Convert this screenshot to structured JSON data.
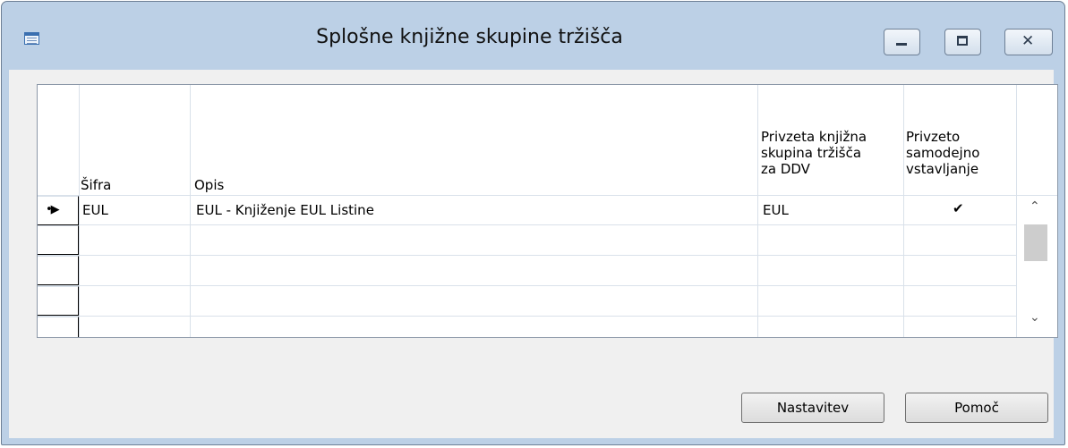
{
  "window": {
    "title": "Splošne knjižne skupine tržišča",
    "close_glyph": "✕",
    "icons": {
      "app": "table-window-icon",
      "minimize": "minimize-icon",
      "maximize": "maximize-icon",
      "close": "close-icon"
    }
  },
  "grid": {
    "columns": [
      {
        "header_lines": [
          "Šifra"
        ]
      },
      {
        "header_lines": [
          "Opis"
        ]
      },
      {
        "header_lines": [
          "Privzeta knjižna",
          "skupina tržišča",
          "za DDV"
        ]
      },
      {
        "header_lines": [
          "Privzeto",
          "samodejno",
          "vstavljanje"
        ]
      }
    ],
    "rows": [
      {
        "marker": "•▶",
        "code": "EUL",
        "description": "EUL - Knjiženje EUL Listine",
        "vat_group": "EUL",
        "auto_insert": "✔"
      }
    ],
    "scroll_up": "⌃",
    "scroll_down": "⌄"
  },
  "buttons": {
    "setup": "Nastavitev",
    "help": "Pomoč"
  }
}
